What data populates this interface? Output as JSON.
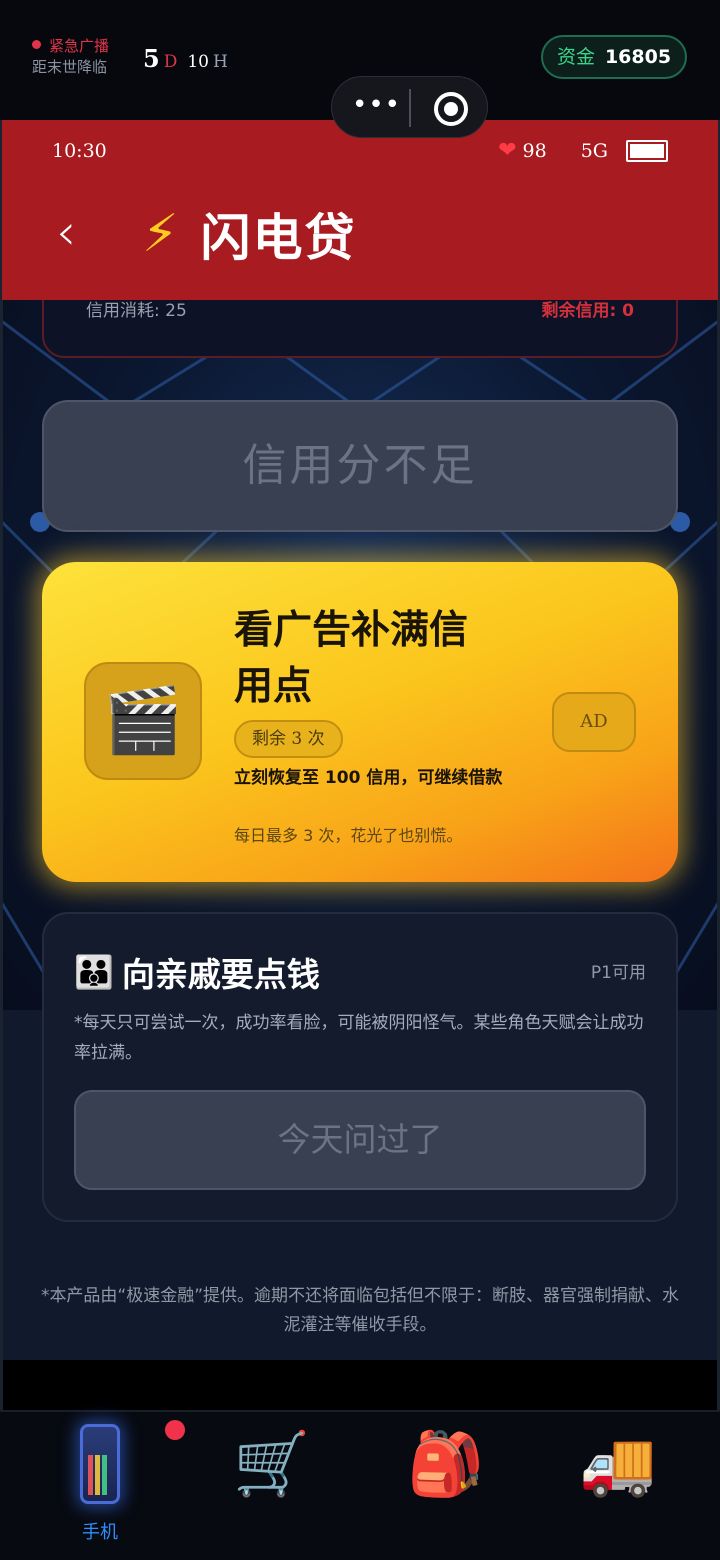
{
  "game_bar": {
    "broadcast_line1": "紧急广播",
    "broadcast_line2": "距末世降临",
    "days": "5",
    "days_unit": "D",
    "hours": "10",
    "hours_unit": "H",
    "funds_label": "资金",
    "funds_value": "16805"
  },
  "capsule": {
    "more_icon": "more-dots-icon",
    "close_icon": "target-close-icon"
  },
  "status_bar": {
    "time": "10:30",
    "heart_icon": "heart-icon",
    "health": "98",
    "network": "5G",
    "battery_level": 1.0
  },
  "header": {
    "back_icon": "chevron-left-icon",
    "title_icon": "lightning-icon",
    "title": "闪电贷"
  },
  "prev_card": {
    "credit_cost": "信用消耗: 25",
    "remaining_credit": "剩余信用: 0"
  },
  "no_credit_button": {
    "label": "信用分不足"
  },
  "ad_card": {
    "icon": "clapperboard-icon",
    "title": "看广告补满信用点",
    "remaining": "剩余 3 次",
    "description": "立刻恢复至 100 信用，可继续借款",
    "note": "每日最多 3 次，花光了也别慌。",
    "badge": "AD"
  },
  "relatives_card": {
    "icon": "family-icon",
    "title": "向亲戚要点钱",
    "tag": "P1可用",
    "description": "*每天只可尝试一次，成功率看脸，可能被阴阳怪气。某些角色天赋会让成功率拉满。",
    "button_label": "今天问过了"
  },
  "disclaimer": "*本产品由“极速金融”提供。逾期不还将面临包括但不限于：断肢、器官强制捐献、水泥灌注等催收手段。",
  "bottom_nav": {
    "items": [
      {
        "icon": "phone-icon",
        "label": "手机",
        "active": true,
        "badge": true
      },
      {
        "icon": "shopping-cart-icon",
        "label": ""
      },
      {
        "icon": "backpack-icon",
        "label": ""
      },
      {
        "icon": "truck-icon",
        "label": ""
      }
    ]
  },
  "colors": {
    "header_red": "#a81b21",
    "accent_blue": "#2e8fff",
    "ad_yellow": "#fbc61d",
    "funds_green": "#3cd38b"
  }
}
